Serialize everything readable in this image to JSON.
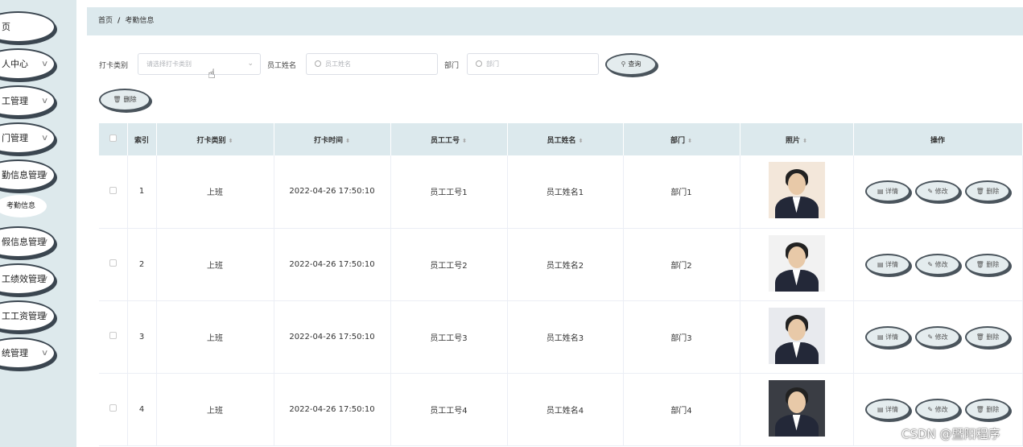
{
  "sidebar": {
    "items": [
      {
        "label": "页",
        "chevron": false
      },
      {
        "label": "人中心",
        "chevron": true
      },
      {
        "label": "工管理",
        "chevron": true
      },
      {
        "label": "门管理",
        "chevron": true
      },
      {
        "label": "勤信息管理",
        "chevron": true
      },
      {
        "label": "假信息管理",
        "chevron": true
      },
      {
        "label": "工绩效管理",
        "chevron": true
      },
      {
        "label": "工工资管理",
        "chevron": true
      },
      {
        "label": "统管理",
        "chevron": true
      }
    ],
    "active_sub": "考勤信息"
  },
  "breadcrumb": {
    "home": "首页",
    "sep": "/",
    "current": "考勤信息"
  },
  "search": {
    "type_label": "打卡类别",
    "type_placeholder": "请选择打卡类别",
    "name_label": "员工姓名",
    "name_placeholder": "员工姓名",
    "dept_label": "部门",
    "dept_placeholder": "部门",
    "query_button": "查询"
  },
  "toolbar": {
    "delete_button": "删除"
  },
  "table": {
    "headers": [
      "索引",
      "打卡类别",
      "打卡时间",
      "员工工号",
      "员工姓名",
      "部门",
      "照片",
      "操作"
    ],
    "rows": [
      {
        "index": "1",
        "type": "上班",
        "time": "2022-04-26 17:50:10",
        "emp_no": "员工工号1",
        "name": "员工姓名1",
        "dept": "部门1",
        "photo_bg": "#f3e7da"
      },
      {
        "index": "2",
        "type": "上班",
        "time": "2022-04-26 17:50:10",
        "emp_no": "员工工号2",
        "name": "员工姓名2",
        "dept": "部门2",
        "photo_bg": "#f2f2f2"
      },
      {
        "index": "3",
        "type": "上班",
        "time": "2022-04-26 17:50:10",
        "emp_no": "员工工号3",
        "name": "员工姓名3",
        "dept": "部门3",
        "photo_bg": "#e8eaee"
      },
      {
        "index": "4",
        "type": "上班",
        "time": "2022-04-26 17:50:10",
        "emp_no": "员工工号4",
        "name": "员工姓名4",
        "dept": "部门4",
        "photo_bg": "#3a3d44"
      }
    ],
    "actions": {
      "detail": "详情",
      "edit": "修改",
      "delete": "删除"
    }
  },
  "watermark": "CSDN @暨阳程序",
  "colors": {
    "sidebar_bg": "#dde9ec",
    "header_bg": "#dce9ed",
    "button_bg": "#e4ecee"
  }
}
